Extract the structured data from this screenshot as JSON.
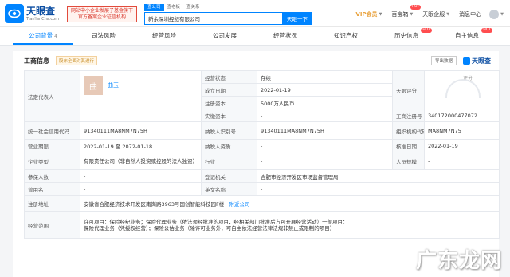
{
  "brand": {
    "name": "天眼查",
    "url": "TianYanCha.com"
  },
  "promo": {
    "line1": "网站中小企业发展子基金旗下",
    "line2": "官方备案企业征信机构"
  },
  "search": {
    "tabs": [
      "查公司",
      "查老板",
      "查关系"
    ],
    "value": "新余深圳经纪有限公司",
    "button": "天眼一下"
  },
  "topnav": {
    "vip": "VIP会员",
    "items": [
      "百宝箱",
      "天眼企服",
      "消息中心"
    ],
    "hot": "HOT"
  },
  "tabs": [
    {
      "label": "公司背景",
      "count": "4"
    },
    {
      "label": "司法风险"
    },
    {
      "label": "经营风险"
    },
    {
      "label": "公司发展"
    },
    {
      "label": "经营状况"
    },
    {
      "label": "知识产权"
    },
    {
      "label": "历史信息",
      "hot": "HOT"
    },
    {
      "label": "自主信息",
      "hot": "HOT"
    }
  ],
  "section": {
    "title": "工商信息",
    "tag": "股东全面对其进行",
    "export": "导出数据",
    "brand": "天眼查"
  },
  "info": {
    "legal_rep_label": "法定代表人",
    "legal_rep_avatar": "曲",
    "legal_rep_name": "曲玉",
    "status_label": "经营状态",
    "status": "存续",
    "founded_label": "成立日期",
    "founded": "2022-01-19",
    "capital_label": "注册资本",
    "capital": "5000万人民币",
    "paid_label": "实缴资本",
    "paid": "-",
    "score_label": "天眼评分",
    "score_caption": "评分",
    "reg_no_label": "工商注册号",
    "reg_no": "340172000477072",
    "credit_label": "统一社会信用代码",
    "credit": "91340111MA8NM7N75H",
    "taxid_label": "纳税人识别号",
    "taxid": "91340111MA8NM7N75H",
    "org_label": "组织机构代码",
    "org": "MA8NM7N75",
    "term_label": "营业期限",
    "term": "2022-01-19 至 2072-01-18",
    "taxpayer_label": "纳税人资质",
    "taxpayer": "-",
    "approved_label": "核准日期",
    "approved": "2022-01-19",
    "type_label": "企业类型",
    "type": "有限责任公司（非自然人投资或控股的法人独资）",
    "industry_label": "行业",
    "industry": "-",
    "staff_label": "人员规模",
    "staff": "-",
    "insured_label": "参保人数",
    "insured": "-",
    "authority_label": "登记机关",
    "authority": "合肥市经济开发区市场监督管理局",
    "former_label": "曾用名",
    "former": "-",
    "english_label": "英文名称",
    "english": "-",
    "address_label": "注册地址",
    "address": "安徽省合肥经济技术开发区南岗路3963号国创智能科技园F楼",
    "address_link": "附近公司",
    "scope_label": "经营范围",
    "scope_1": "许可项目：保险经纪业务；保险代理业务（依法须经批准的项目，经相关部门批准后方可开展经营活动）一般项目：",
    "scope_2": "保险代理业务（凭授权经营）；保险公估业务（除许可业务外，可自主依法经营法律法规非禁止或限制的项目）"
  },
  "watermark": "广东龙网"
}
